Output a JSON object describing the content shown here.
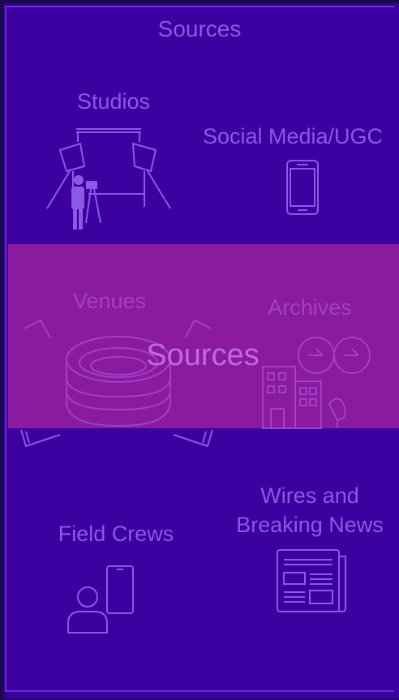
{
  "diagram": {
    "title": "Sources",
    "nodes": {
      "studios": "Studios",
      "social_media": "Social Media/UGC",
      "venues": "Venues",
      "archives": "Archives",
      "field_crews": "Field Crews",
      "wires_line1": "Wires and",
      "wires_line2": "Breaking News"
    },
    "overlay_title": "Sources"
  },
  "colors": {
    "background": "#3c00a0",
    "overlay": "#8a1a9e",
    "text": "#8a5ae6"
  }
}
